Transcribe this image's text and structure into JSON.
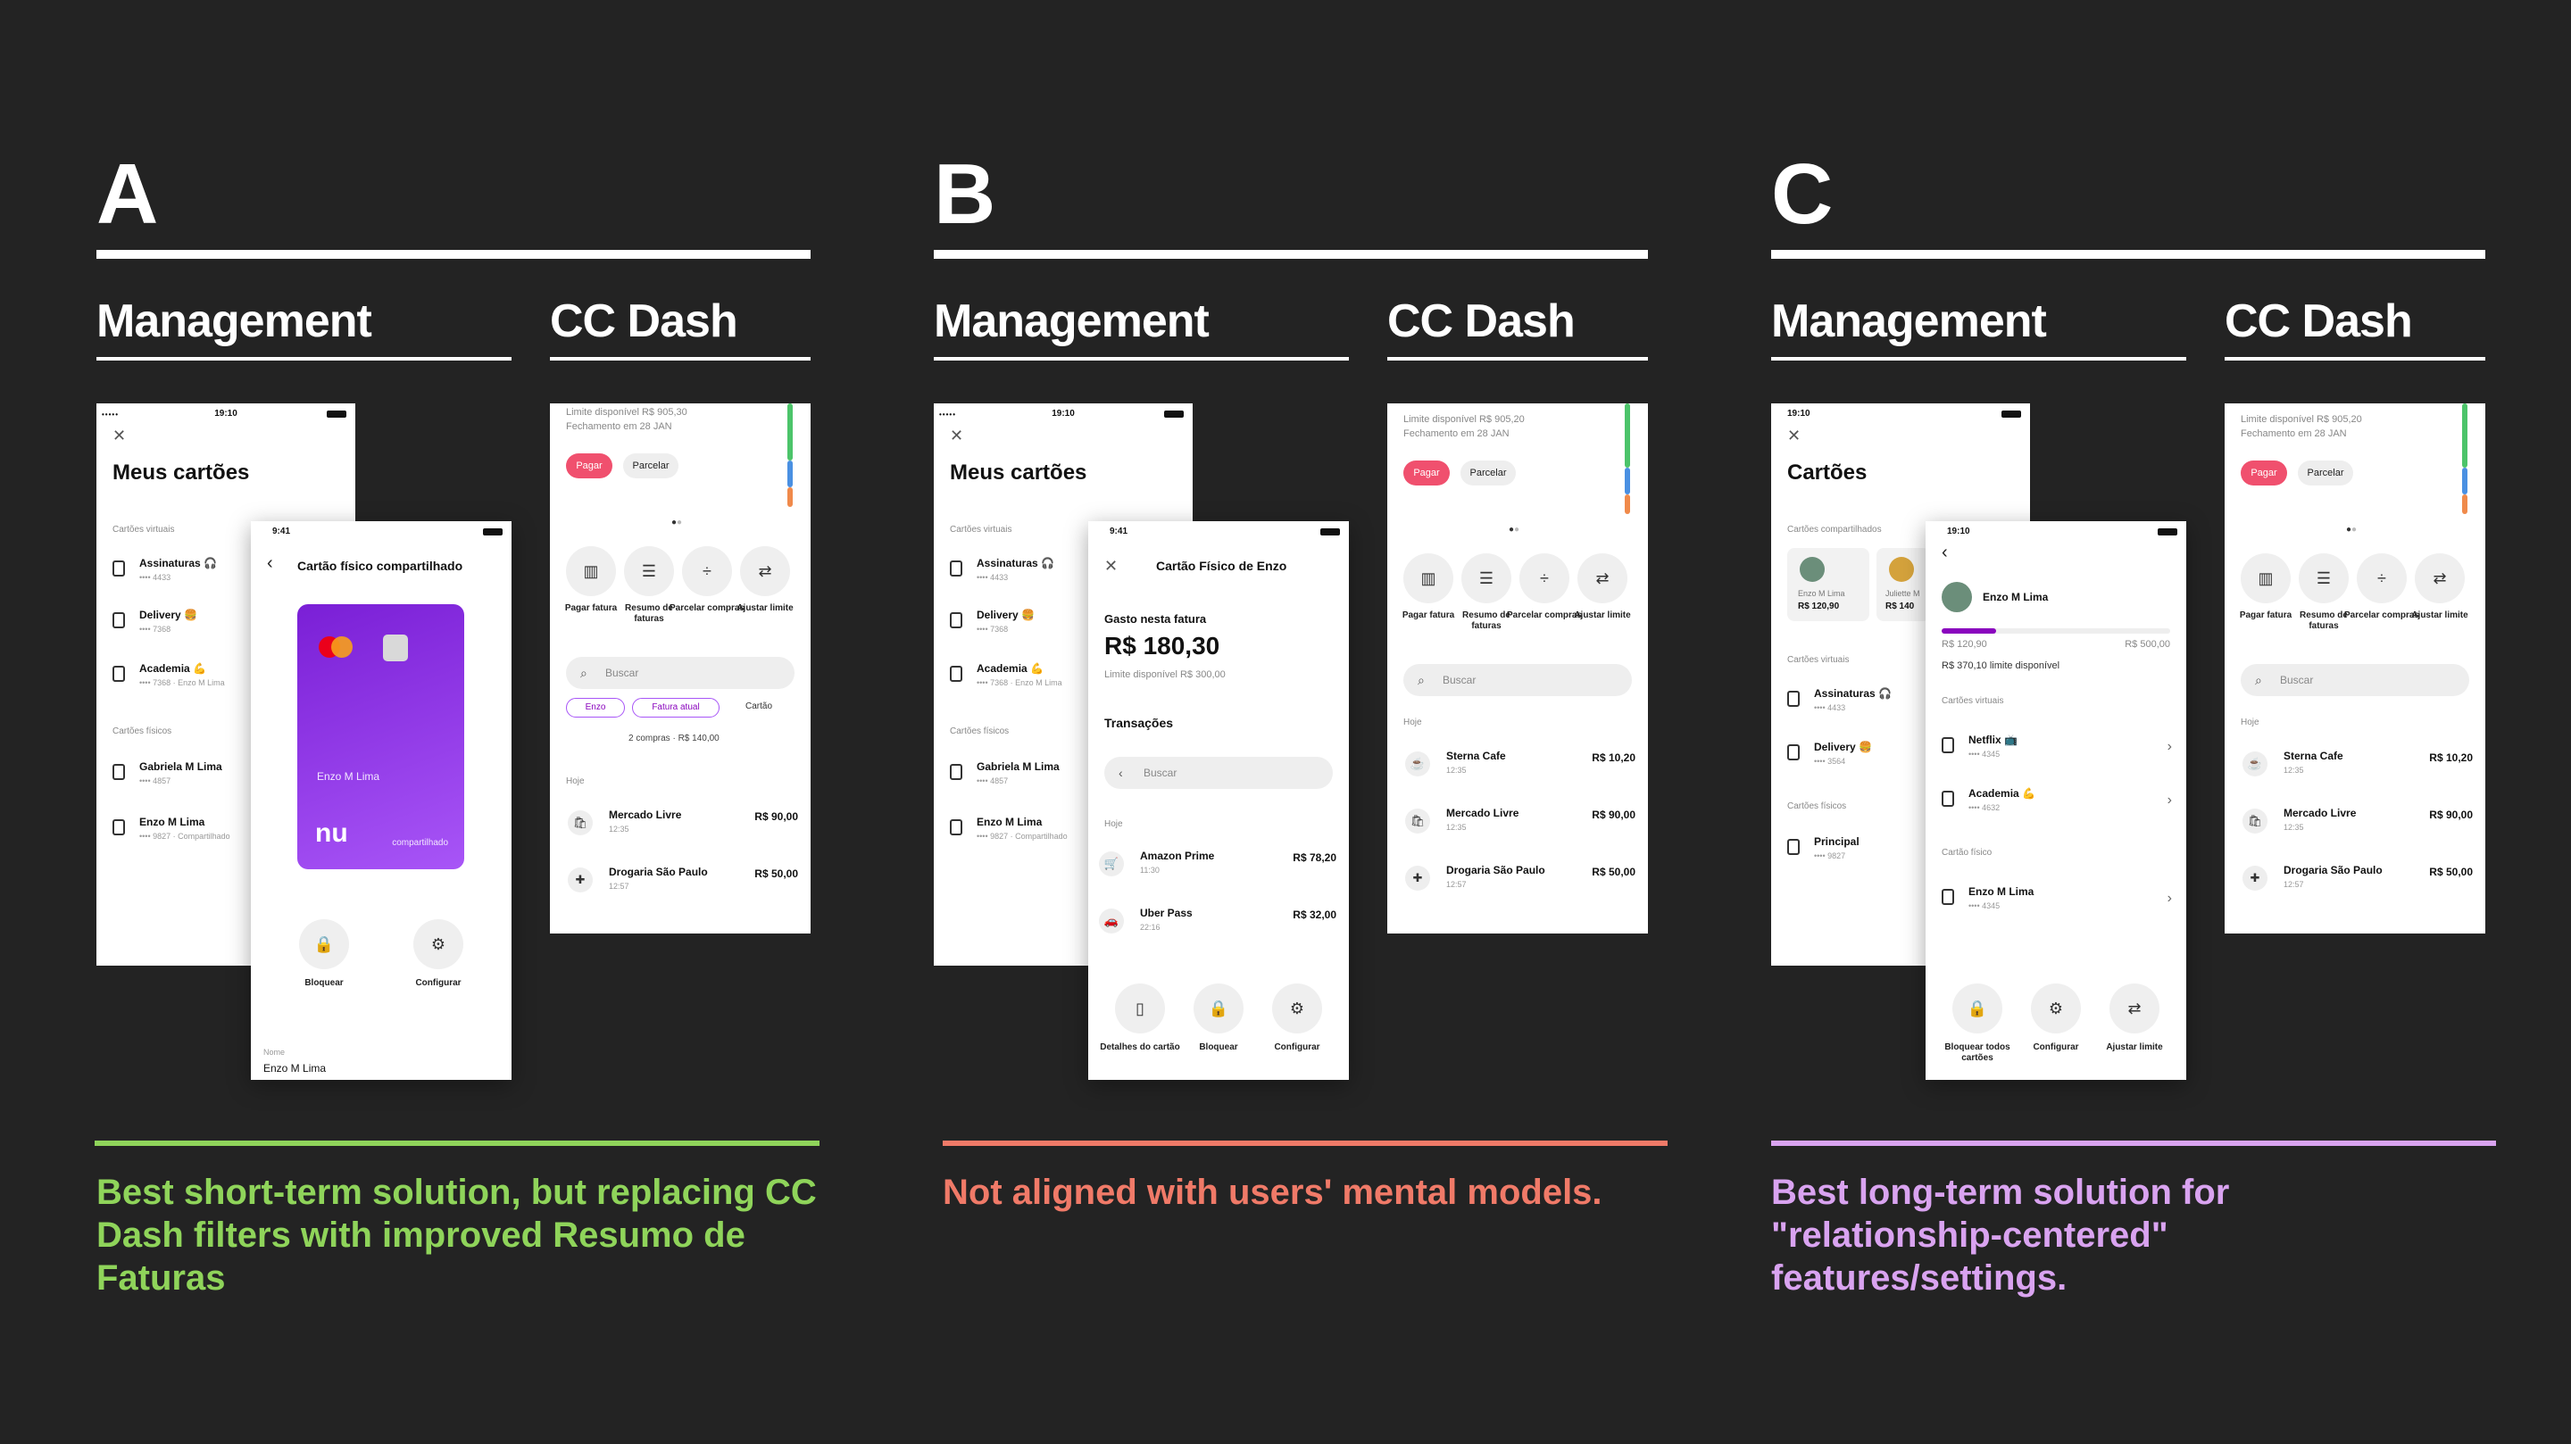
{
  "columns": [
    {
      "letter": "A",
      "management_label": "Management",
      "dash_label": "CC Dash",
      "note": "Best short-term solution, but replacing CC Dash filters with improved Resumo de Faturas",
      "note_color": "#8fd45a"
    },
    {
      "letter": "B",
      "management_label": "Management",
      "dash_label": "CC Dash",
      "note": "Not aligned with users' mental models.",
      "note_color": "#f07a68"
    },
    {
      "letter": "C",
      "management_label": "Management",
      "dash_label": "CC Dash",
      "note": "Best long-term solution for \"relationship-centered\" features/settings.",
      "note_color": "#d9a3f0"
    }
  ],
  "screens": {
    "a_back": {
      "time": "19:10",
      "title": "Meus cartões",
      "virtual_label": "Cartões virtuais",
      "physical_label": "Cartões físicos",
      "items": [
        {
          "name": "Assinaturas 🎧",
          "sub": "•••• 4433"
        },
        {
          "name": "Delivery 🍔",
          "sub": "•••• 7368"
        },
        {
          "name": "Academia 💪",
          "sub": "•••• 7368 · Enzo M Lima"
        },
        {
          "name": "Gabriela M Lima",
          "sub": "•••• 4857"
        },
        {
          "name": "Enzo M Lima",
          "sub": "•••• 9827 · Compartilhado"
        }
      ]
    },
    "a_front": {
      "time": "9:41",
      "title": "Cartão físico compartilhado",
      "card_name": "Enzo M Lima",
      "card_brand": "nu",
      "card_tag": "compartilhado",
      "btn1": "Bloquear",
      "btn2": "Configurar",
      "field_label": "Nome",
      "field_value": "Enzo M Lima"
    },
    "a_dash": {
      "limit": "Limite disponível R$ 905,30",
      "closing": "Fechamento em 28 JAN",
      "pay": "Pagar",
      "split": "Parcelar",
      "actions": [
        "Pagar fatura",
        "Resumo de faturas",
        "Parcelar compras",
        "Ajustar limite"
      ],
      "search": "Buscar",
      "chips": [
        "Enzo",
        "Fatura atual",
        "Cartão"
      ],
      "summary": "2 compras · R$ 140,00",
      "today": "Hoje",
      "tx": [
        {
          "name": "Mercado Livre",
          "time": "12:35",
          "value": "R$ 90,00"
        },
        {
          "name": "Drogaria São Paulo",
          "time": "12:57",
          "value": "R$ 50,00"
        }
      ]
    },
    "b_back": {
      "time": "19:10",
      "title": "Meus cartões",
      "virtual_label": "Cartões virtuais",
      "physical_label": "Cartões físicos",
      "items": [
        {
          "name": "Assinaturas 🎧",
          "sub": "•••• 4433"
        },
        {
          "name": "Delivery 🍔",
          "sub": "•••• 7368"
        },
        {
          "name": "Academia 💪",
          "sub": "•••• 7368 · Enzo M Lima"
        },
        {
          "name": "Gabriela M Lima",
          "sub": "•••• 4857"
        },
        {
          "name": "Enzo M Lima",
          "sub": "•••• 9827 · Compartilhado"
        }
      ]
    },
    "b_front": {
      "time": "9:41",
      "title": "Cartão Físico de Enzo",
      "spent_label": "Gasto nesta fatura",
      "spent": "R$ 180,30",
      "limit": "Limite disponível R$ 300,00",
      "tx_label": "Transações",
      "search": "Buscar",
      "today": "Hoje",
      "tx": [
        {
          "name": "Amazon Prime",
          "time": "11:30",
          "value": "R$ 78,20"
        },
        {
          "name": "Uber Pass",
          "time": "22:16",
          "value": "R$ 32,00"
        }
      ],
      "btns": [
        "Detalhes do cartão",
        "Bloquear",
        "Configurar"
      ]
    },
    "b_dash": {
      "limit": "Limite disponível R$ 905,20",
      "closing": "Fechamento em 28 JAN",
      "pay": "Pagar",
      "split": "Parcelar",
      "actions": [
        "Pagar fatura",
        "Resumo de faturas",
        "Parcelar compras",
        "Ajustar limite"
      ],
      "search": "Buscar",
      "today": "Hoje",
      "tx": [
        {
          "name": "Sterna Cafe",
          "time": "12:35",
          "value": "R$ 10,20"
        },
        {
          "name": "Mercado Livre",
          "time": "12:35",
          "value": "R$ 90,00"
        },
        {
          "name": "Drogaria São Paulo",
          "time": "12:57",
          "value": "R$ 50,00"
        }
      ]
    },
    "c_back": {
      "time": "19:10",
      "title": "Cartões",
      "shared_label": "Cartões compartilhados",
      "shared": [
        {
          "name": "Enzo M Lima",
          "value": "R$ 120,90"
        },
        {
          "name": "Juliette M",
          "value": "R$ 140"
        }
      ],
      "virtual_label": "Cartões virtuais",
      "physical_label": "Cartões físicos",
      "items": [
        {
          "name": "Assinaturas 🎧",
          "sub": "•••• 4433"
        },
        {
          "name": "Delivery 🍔",
          "sub": "•••• 3564"
        },
        {
          "name": "Principal",
          "sub": "•••• 9827"
        }
      ]
    },
    "c_front": {
      "time": "19:10",
      "person": "Enzo M Lima",
      "used": "R$ 120,90",
      "total": "R$ 500,00",
      "available": "R$ 370,10 limite disponível",
      "progress": 0.24,
      "virtual_label": "Cartões virtuais",
      "items": [
        {
          "name": "Netflix 📺",
          "sub": "•••• 4345"
        },
        {
          "name": "Academia 💪",
          "sub": "•••• 4632"
        }
      ],
      "physical_label": "Cartão físico",
      "physical": {
        "name": "Enzo M Lima",
        "sub": "•••• 4345"
      },
      "btns": [
        "Bloquear todos cartões",
        "Configurar",
        "Ajustar limite"
      ]
    },
    "c_dash": {
      "limit": "Limite disponível R$ 905,20",
      "closing": "Fechamento em 28 JAN",
      "pay": "Pagar",
      "split": "Parcelar",
      "actions": [
        "Pagar fatura",
        "Resumo de faturas",
        "Parcelar compras",
        "Ajustar limite"
      ],
      "search": "Buscar",
      "today": "Hoje",
      "tx": [
        {
          "name": "Sterna Cafe",
          "time": "12:35",
          "value": "R$ 10,20"
        },
        {
          "name": "Mercado Livre",
          "time": "12:35",
          "value": "R$ 90,00"
        },
        {
          "name": "Drogaria São Paulo",
          "time": "12:57",
          "value": "R$ 50,00"
        }
      ]
    }
  },
  "colors": {
    "background": "#232323",
    "accent_pink": "#f0506e",
    "purple": "#8a05be"
  }
}
